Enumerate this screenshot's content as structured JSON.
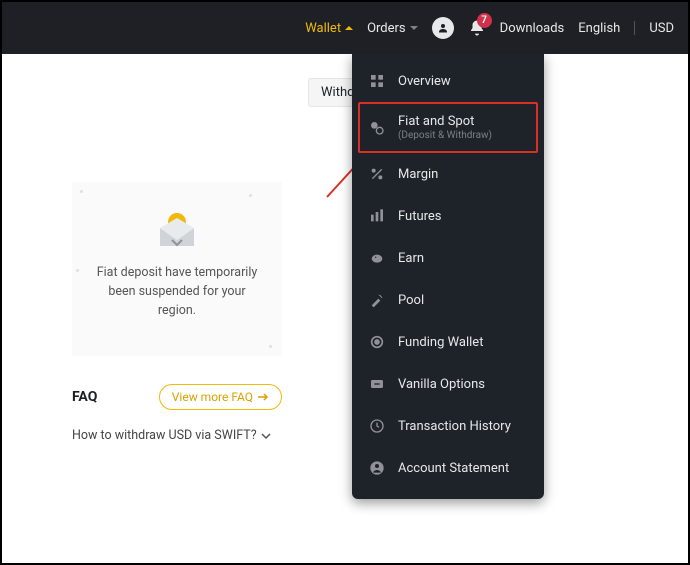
{
  "topbar": {
    "wallet": "Wallet",
    "orders": "Orders",
    "downloads": "Downloads",
    "language": "English",
    "currency": "USD",
    "notification_count": "7"
  },
  "tab": {
    "withdraw": "Withdra"
  },
  "dropdown": {
    "overview": "Overview",
    "fiat_spot": {
      "label": "Fiat and Spot",
      "sub": "(Deposit & Withdraw)"
    },
    "margin": "Margin",
    "futures": "Futures",
    "earn": "Earn",
    "pool": "Pool",
    "funding": "Funding Wallet",
    "vanilla": "Vanilla Options",
    "tx_history": "Transaction History",
    "statement": "Account Statement"
  },
  "card": {
    "line1": "Fiat deposit have temporarily",
    "line2": "been suspended for your region."
  },
  "faq": {
    "title": "FAQ",
    "view_more": "View more FAQ",
    "q1": "How to withdraw USD via SWIFT?"
  },
  "colors": {
    "accent": "#f0b90b",
    "bg_dark": "#1e2026",
    "bg_dropdown": "#1e2329",
    "highlight_red": "#d93025",
    "badge_red": "#cf304a"
  }
}
